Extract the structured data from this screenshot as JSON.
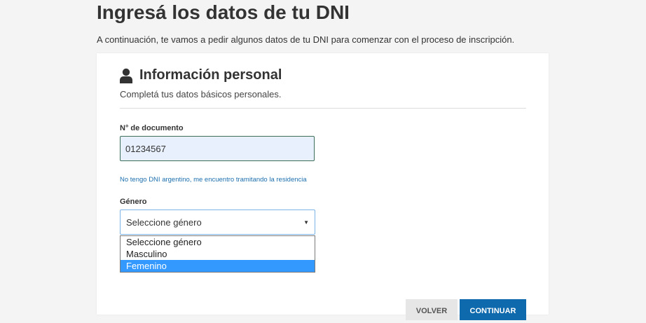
{
  "header": {
    "title": "Ingresá los datos de tu DNI",
    "subtitle": "A continuación, te vamos a pedir algunos datos de tu DNI para comenzar con el proceso de inscripción."
  },
  "section": {
    "icon": "user-icon",
    "title": "Información personal",
    "description": "Completá tus datos básicos personales."
  },
  "form": {
    "document": {
      "label": "N° de documento",
      "value": "01234567"
    },
    "no_dni_link": "No tengo DNI argentino, me encuentro tramitando la residencia",
    "gender": {
      "label": "Género",
      "selected_value": "Seleccione género",
      "options": [
        "Seleccione género",
        "Masculino",
        "Femenino"
      ],
      "highlighted_option": "Femenino"
    }
  },
  "buttons": {
    "back": "VOLVER",
    "continue": "CONTINUAR"
  },
  "colors": {
    "background": "#f4f4f4",
    "primary": "#0e6aad",
    "link": "#1d6fae",
    "input_autofill": "#e8f0fe",
    "option_highlight": "#3399ff"
  }
}
